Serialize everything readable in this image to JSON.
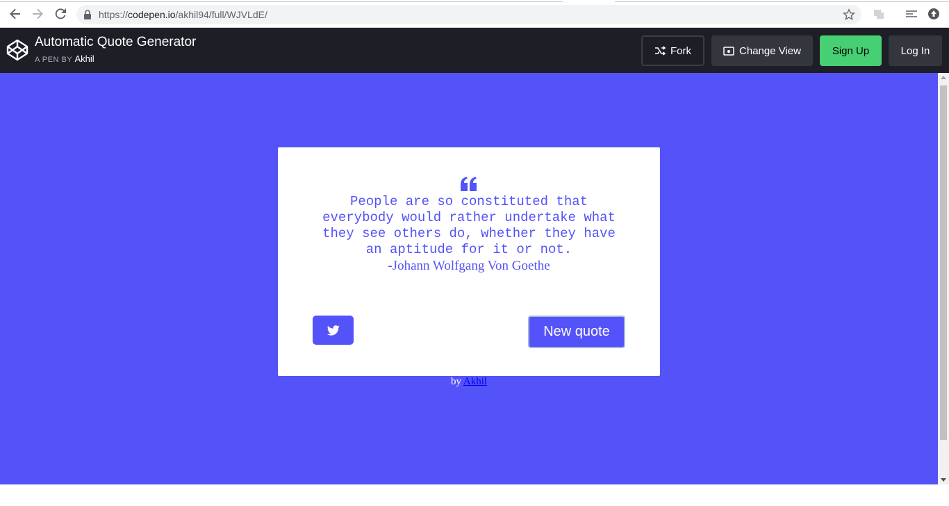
{
  "browser": {
    "url_prefix": "https://",
    "url_host": "codepen.io",
    "url_path": "/akhil94/full/WJVLdE/"
  },
  "header": {
    "title": "Automatic Quote Generator",
    "byline_prefix": "A PEN BY",
    "author": "Akhil",
    "buttons": {
      "fork": "Fork",
      "change_view": "Change View",
      "sign_up": "Sign Up",
      "log_in": "Log In"
    }
  },
  "quote": {
    "text": "People are so constituted that everybody would rather undertake what they see others do, whether they have an aptitude for it or not.",
    "author": "-Johann Wolfgang Von Goethe",
    "new_quote_label": "New quote"
  },
  "footer": {
    "by": "by",
    "author_link": "Akhil"
  },
  "colors": {
    "accent": "#5452f9",
    "header_bg": "#1e1f26",
    "sign_up_green": "#47cf73"
  },
  "icons": {
    "back": "arrow-left-icon",
    "forward": "arrow-right-icon",
    "reload": "reload-icon",
    "lock": "lock-icon",
    "bookmark": "star-icon",
    "codepen_logo": "codepen-logo-icon",
    "fork": "fork-icon",
    "change_view": "view-icon",
    "quote": "quote-left-icon",
    "tweet": "twitter-icon"
  }
}
